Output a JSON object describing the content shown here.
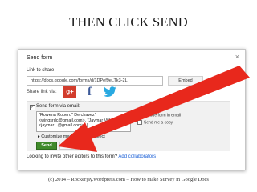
{
  "slide": {
    "title": "THEN CLICK SEND",
    "footer": "(c) 2014 – Rockerjay.wordpress.com – How to make Survey in Google Docs"
  },
  "dialog": {
    "title": "Send form",
    "close_icon": "×",
    "link_label": "Link to share",
    "link_value": "https://docs.google.com/forms/d/1DPef9eLTk3-2L",
    "embed_label": "Embed",
    "share_label": "Share link via:",
    "share_icons": [
      "google-plus-icon",
      "facebook-icon",
      "twitter-icon"
    ],
    "gplus_text": "g+",
    "fb_text": "f"
  },
  "email": {
    "label": "Send form via email:",
    "recipients": "\"Rowena Ropero\" De chavez\" <wingsrdc@gmail.com>, \"Jaymar Villamor\" <jaymar...@gmail.com>, |",
    "options": [
      {
        "label": "Include form in email",
        "checked": true
      },
      {
        "label": "Send me a copy",
        "checked": false
      }
    ],
    "customize_label": "Customize message and subject",
    "send_label": "Send",
    "cancel_label": "Cancel"
  },
  "invite": {
    "text": "Looking to invite other editors to this form?",
    "link": "Add collaborators"
  },
  "colors": {
    "arrow": "#e8281c",
    "send_button": "#3f8a2a",
    "link": "#1a5fd6"
  }
}
